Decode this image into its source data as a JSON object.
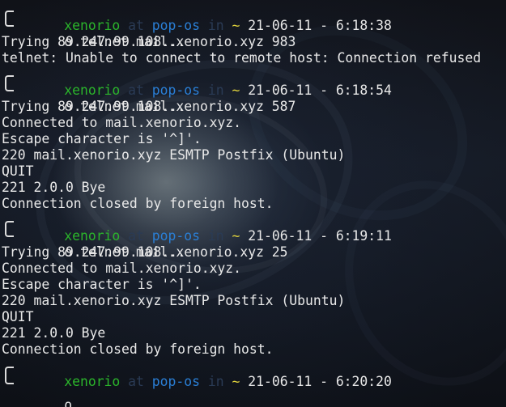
{
  "prompt": {
    "user": "xenorio",
    "at": "at",
    "host": "pop-os",
    "in": "in",
    "dir": "~",
    "sep": "-",
    "bullet": "o"
  },
  "sessions": [
    {
      "time": "21-06-11 - 6:18:38",
      "command": "telnet mail.xenorio.xyz 983",
      "output": [
        "Trying 89.247.99.108...",
        "telnet: Unable to connect to remote host: Connection refused"
      ]
    },
    {
      "time": "21-06-11 - 6:18:54",
      "command": "telnet mail.xenorio.xyz 587",
      "output": [
        "Trying 89.247.99.108...",
        "Connected to mail.xenorio.xyz.",
        "Escape character is '^]'.",
        "220 mail.xenorio.xyz ESMTP Postfix (Ubuntu)",
        "QUIT",
        "221 2.0.0 Bye",
        "Connection closed by foreign host."
      ]
    },
    {
      "time": "21-06-11 - 6:19:11",
      "command": "telnet mail.xenorio.xyz 25",
      "output": [
        "Trying 89.247.99.108...",
        "Connected to mail.xenorio.xyz.",
        "Escape character is '^]'.",
        "220 mail.xenorio.xyz ESMTP Postfix (Ubuntu)",
        "QUIT",
        "221 2.0.0 Bye",
        "Connection closed by foreign host."
      ]
    },
    {
      "time": "21-06-11 - 6:20:20",
      "command": "",
      "output": []
    }
  ],
  "cursor": "_",
  "colors": {
    "user": "#2bb52b",
    "host": "#2a7fd6",
    "dir": "#e2d43c",
    "muted": "#2a3b55",
    "text": "#e9e9e9"
  }
}
